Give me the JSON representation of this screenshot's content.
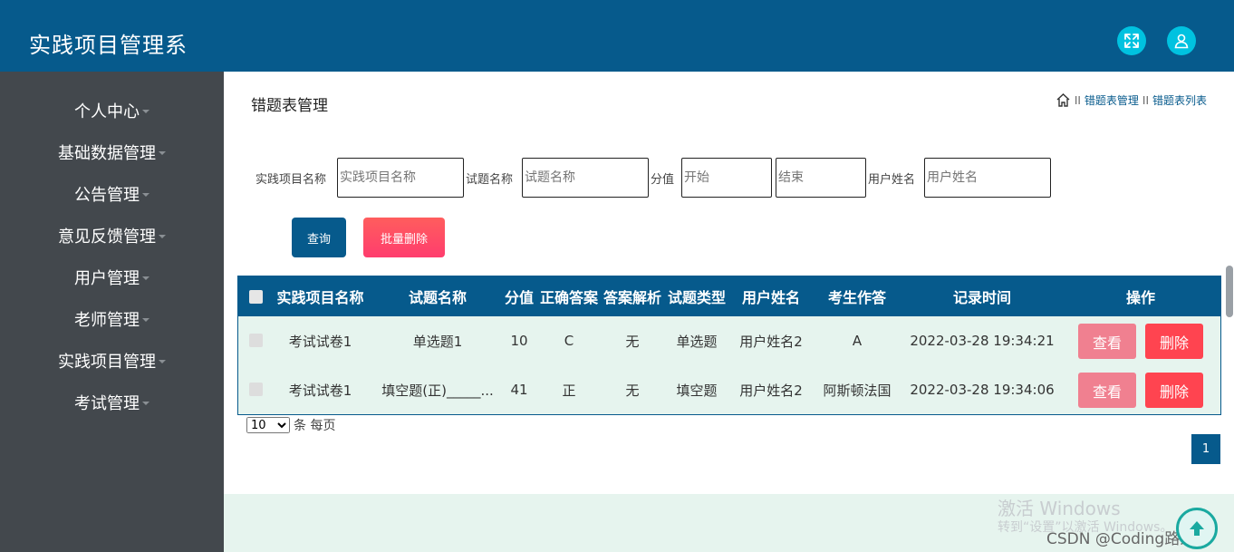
{
  "header": {
    "app_title": "实践项目管理系",
    "fullscreen_icon": "fullscreen-icon",
    "user_icon": "user-icon"
  },
  "sidebar": {
    "items": [
      {
        "label": "个人中心"
      },
      {
        "label": "基础数据管理"
      },
      {
        "label": "公告管理"
      },
      {
        "label": "意见反馈管理"
      },
      {
        "label": "用户管理"
      },
      {
        "label": "老师管理"
      },
      {
        "label": "实践项目管理"
      },
      {
        "label": "考试管理"
      }
    ]
  },
  "page": {
    "title": "错题表管理",
    "breadcrumb": {
      "sep1": "II",
      "crumb1": "错题表管理",
      "sep2": "II",
      "crumb2": "错题表列表"
    }
  },
  "filters": {
    "project_label": "实践项目名称",
    "project_placeholder": "实践项目名称",
    "question_label": "试题名称",
    "question_placeholder": "试题名称",
    "score_label": "分值",
    "score_start_placeholder": "开始",
    "score_end_placeholder": "结束",
    "username_label": "用户姓名",
    "username_placeholder": "用户姓名"
  },
  "actions": {
    "query_label": "查询",
    "batch_delete_label": "批量删除"
  },
  "table": {
    "headers": {
      "project": "实践项目名称",
      "question": "试题名称",
      "score": "分值",
      "answer": "正确答案",
      "analysis": "答案解析",
      "type": "试题类型",
      "username": "用户姓名",
      "student_answer": "考生作答",
      "time": "记录时间",
      "operation": "操作"
    },
    "rows": [
      {
        "project": "考试试卷1",
        "question": "单选题1",
        "score": "10",
        "answer": "C",
        "analysis": "无",
        "type": "单选题",
        "username": "用户姓名2",
        "student_answer": "A",
        "time": "2022-03-28 19:34:21",
        "view_label": "查看",
        "delete_label": "删除"
      },
      {
        "project": "考试试卷1",
        "question": "填空题(正)_____...",
        "score": "41",
        "answer": "正",
        "analysis": "无",
        "type": "填空题",
        "username": "用户姓名2",
        "student_answer": "阿斯顿法国",
        "time": "2022-03-28 19:34:06",
        "view_label": "查看",
        "delete_label": "删除"
      }
    ]
  },
  "pagination": {
    "page_size": "10",
    "page_size_suffix": "条 每页",
    "current_page": "1"
  },
  "overlay": {
    "windows_activate_title": "激活 Windows",
    "windows_activate_hint": "转到“设置”以激活 Windows。",
    "csdn_watermark": "CSDN @Coding路人王"
  },
  "colors": {
    "primary": "#065a8c",
    "accent_cyan": "#00c2e0",
    "danger": "#ff4450",
    "view_pink": "#f08090",
    "row_bg": "#e6f4ee",
    "sidebar_bg": "#43484d"
  }
}
